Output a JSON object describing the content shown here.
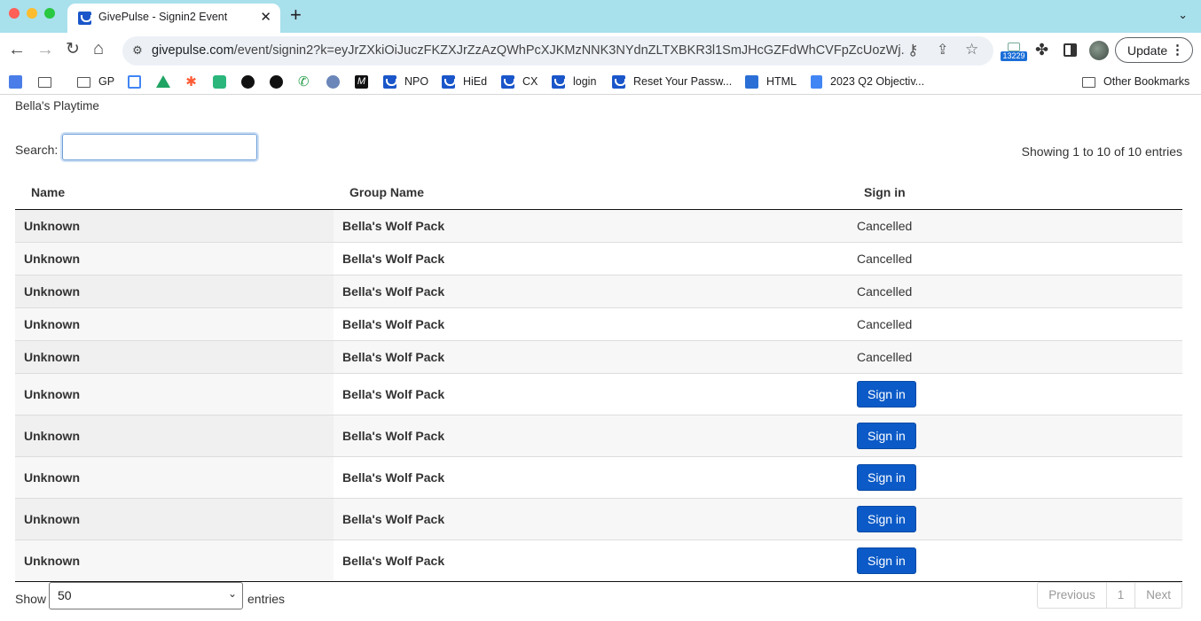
{
  "browser": {
    "tab_title": "GivePulse - Signin2 Event",
    "tab_close": "✕",
    "new_tab": "+",
    "url_host": "givepulse.com",
    "url_path": "/event/signin2?k=eyJrZXkiOiJuczFKZXJrZzAzQWhPcXJKMzNNK3NYdnZLTXBKR3l1SmJHcGZFdWhCVFpZcUozWj...",
    "update_label": "Update",
    "extension_badge": "13229",
    "icons": {
      "back": "arrow-left-icon",
      "forward": "arrow-right-icon",
      "reload": "reload-icon",
      "home": "home-icon",
      "site_info": "tune-icon",
      "password": "key-icon",
      "share": "share-icon",
      "bookmark": "star-icon",
      "extensions": "puzzle-icon",
      "side_panel": "side-panel-icon",
      "menu": "kebab-icon"
    }
  },
  "bookmarks": [
    {
      "label": "",
      "icon": "translate-icon"
    },
    {
      "label": "",
      "icon": "folder-icon"
    },
    {
      "label": "GP",
      "icon": "folder-icon"
    },
    {
      "label": "",
      "icon": "calendar-icon"
    },
    {
      "label": "",
      "icon": "drive-icon"
    },
    {
      "label": "",
      "icon": "hubspot-icon"
    },
    {
      "label": "",
      "icon": "green-app-icon"
    },
    {
      "label": "",
      "icon": "github-icon"
    },
    {
      "label": "",
      "icon": "github-icon"
    },
    {
      "label": "",
      "icon": "phone-icon"
    },
    {
      "label": "",
      "icon": "seal-icon"
    },
    {
      "label": "",
      "icon": "m-icon"
    },
    {
      "label": "NPO",
      "icon": "givepulse-icon"
    },
    {
      "label": "HiEd",
      "icon": "givepulse-icon"
    },
    {
      "label": "CX",
      "icon": "givepulse-icon"
    },
    {
      "label": "login",
      "icon": "givepulse-icon"
    },
    {
      "label": "Reset Your Passw...",
      "icon": "givepulse-icon"
    },
    {
      "label": "HTML",
      "icon": "code-icon"
    },
    {
      "label": "2023 Q2 Objectiv...",
      "icon": "docs-icon"
    }
  ],
  "other_bookmarks": "Other Bookmarks",
  "page": {
    "event_title": "Bella's Playtime",
    "search_label": "Search:",
    "search_value": "",
    "info": "Showing 1 to 10 of 10 entries",
    "columns": [
      "Name",
      "Group Name",
      "Sign in"
    ],
    "rows": [
      {
        "name": "Unknown",
        "group": "Bella's Wolf Pack",
        "status": "Cancelled",
        "button": false
      },
      {
        "name": "Unknown",
        "group": "Bella's Wolf Pack",
        "status": "Cancelled",
        "button": false
      },
      {
        "name": "Unknown",
        "group": "Bella's Wolf Pack",
        "status": "Cancelled",
        "button": false
      },
      {
        "name": "Unknown",
        "group": "Bella's Wolf Pack",
        "status": "Cancelled",
        "button": false
      },
      {
        "name": "Unknown",
        "group": "Bella's Wolf Pack",
        "status": "Cancelled",
        "button": false
      },
      {
        "name": "Unknown",
        "group": "Bella's Wolf Pack",
        "status": "Sign in",
        "button": true
      },
      {
        "name": "Unknown",
        "group": "Bella's Wolf Pack",
        "status": "Sign in",
        "button": true
      },
      {
        "name": "Unknown",
        "group": "Bella's Wolf Pack",
        "status": "Sign in",
        "button": true
      },
      {
        "name": "Unknown",
        "group": "Bella's Wolf Pack",
        "status": "Sign in",
        "button": true
      },
      {
        "name": "Unknown",
        "group": "Bella's Wolf Pack",
        "status": "Sign in",
        "button": true
      }
    ],
    "show_label": "Show",
    "length_value": "50",
    "entries_label": "entries",
    "pagination": {
      "previous": "Previous",
      "current": "1",
      "next": "Next"
    }
  },
  "colors": {
    "tabbar": "#a8e0ec",
    "button_primary": "#0b5ac7",
    "givepulse_blue": "#1a56c9"
  }
}
